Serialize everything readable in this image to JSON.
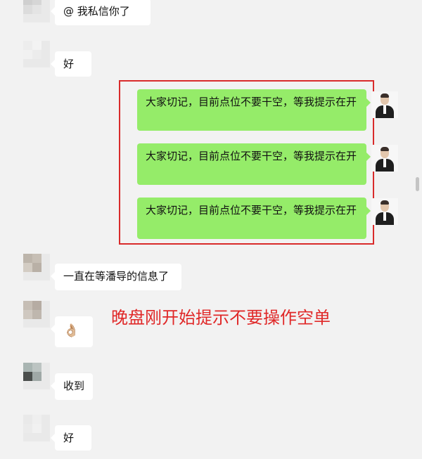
{
  "messages": [
    {
      "id": "m1",
      "side": "in",
      "text": "@   我私信你了"
    },
    {
      "id": "m2",
      "side": "in",
      "text": "好"
    },
    {
      "id": "m3",
      "side": "out",
      "text": "大家切记，目前点位不要干空，等我提示在开"
    },
    {
      "id": "m4",
      "side": "out",
      "text": "大家切记，目前点位不要干空，等我提示在开"
    },
    {
      "id": "m5",
      "side": "out",
      "text": "大家切记，目前点位不要干空，等我提示在开"
    },
    {
      "id": "m6",
      "side": "in",
      "text": "一直在等潘导的信息了"
    },
    {
      "id": "m7",
      "side": "in",
      "text": "👌🏼"
    },
    {
      "id": "m8",
      "side": "in",
      "text": "收到"
    },
    {
      "id": "m9",
      "side": "in",
      "text": "好"
    }
  ],
  "annotation": {
    "text": "晚盘刚开始提示不要操作空单",
    "color": "#e02828"
  },
  "colors": {
    "background": "#f2f2f2",
    "incoming_bubble": "#ffffff",
    "outgoing_bubble": "#95ec69",
    "highlight_border": "#d92b2b"
  }
}
